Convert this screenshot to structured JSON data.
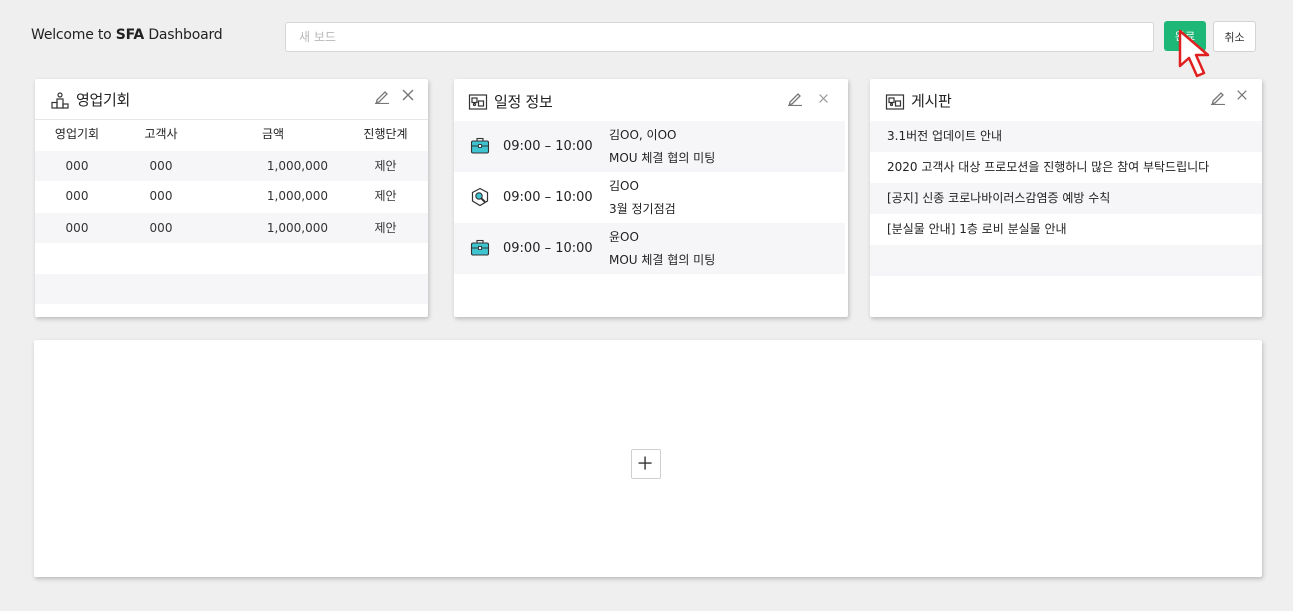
{
  "header": {
    "welcome_prefix": "Welcome to ",
    "welcome_brand": "SFA",
    "welcome_suffix": " Dashboard",
    "board_name_placeholder": "새 보드",
    "done_label": "완료",
    "cancel_label": "취소"
  },
  "colors": {
    "accent": "#1db877",
    "shade": "#f6f6f8",
    "icon_teal": "#3ec3d0"
  },
  "sales_panel": {
    "title": "영업기회",
    "icon": "podium-icon",
    "columns": [
      "영업기회",
      "고객사",
      "금액",
      "진행단계"
    ],
    "rows": [
      [
        "000",
        "000",
        "1,000,000",
        "제안"
      ],
      [
        "000",
        "000",
        "1,000,000",
        "제안"
      ],
      [
        "000",
        "000",
        "1,000,000",
        "제안"
      ]
    ]
  },
  "schedule_panel": {
    "title": "일정 정보",
    "icon": "schedule-board-icon",
    "items": [
      {
        "icon": "briefcase-icon",
        "time": "09:00 – 10:00",
        "who": "김OO, 이OO",
        "what": "MOU 체결 협의 미팅"
      },
      {
        "icon": "wrench-icon",
        "time": "09:00 – 10:00",
        "who": "김OO",
        "what": "3월 정기점검"
      },
      {
        "icon": "briefcase-icon",
        "time": "09:00 – 10:00",
        "who": "윤OO",
        "what": "MOU 체결 협의 미팅"
      }
    ]
  },
  "board_panel": {
    "title": "게시판",
    "icon": "bulletin-board-icon",
    "posts": [
      "3.1버전 업데이트 안내",
      "2020 고객사 대상 프로모션을 진행하니 많은 참여 부탁드립니다",
      "[공지] 신종 코로나바이러스감염증 예방 수칙",
      "[분실물 안내] 1층 로비 분실물 안내"
    ]
  }
}
